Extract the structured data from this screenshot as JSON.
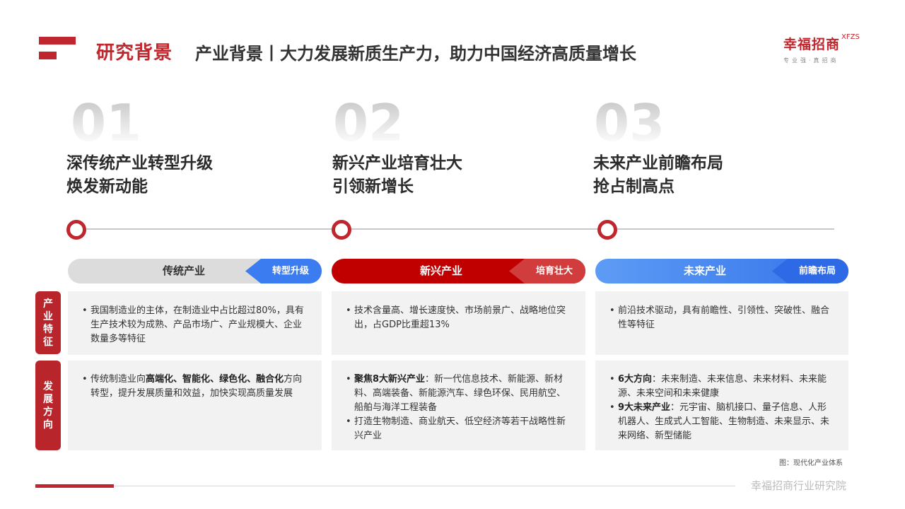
{
  "header": {
    "section": "研究背景",
    "title": "产业背景丨大力发展新质生产力，助力中国经济高质量增长",
    "brand_name": "幸福招商",
    "brand_abbr": "XFZS",
    "brand_slogan": "专业强·真招商"
  },
  "columns": [
    {
      "number": "01",
      "title_line1": "深传统产业转型升级",
      "title_line2": "焕发新动能",
      "pill_label": "传统产业",
      "pill_tag": "转型升级"
    },
    {
      "number": "02",
      "title_line1": "新兴产业培育壮大",
      "title_line2": "引领新增长",
      "pill_label": "新兴产业",
      "pill_tag": "培育壮大"
    },
    {
      "number": "03",
      "title_line1": "未来产业前瞻布局",
      "title_line2": "抢占制高点",
      "pill_label": "未来产业",
      "pill_tag": "前瞻布局"
    }
  ],
  "row_labels": {
    "features": "产业特征",
    "direction": "发展方向"
  },
  "features": [
    "我国制造业的主体，在制造业中占比超过80%，具有生产技术较为成熟、产品市场广、产业规模大、企业数量多等特征",
    "技术含量高、增长速度快、市场前景广、战略地位突出，占GDP比重超13%",
    "前沿技术驱动，具有前瞻性、引领性、突破性、融合性等特征"
  ],
  "direction": {
    "traditional": {
      "prefix": "传统制造业向",
      "k1": "高端化",
      "sep1": "、",
      "k2": "智能化",
      "sep2": "、",
      "k3": "绿色化",
      "sep3": "、",
      "k4": "融合化",
      "suffix": "方向转型，提升发展质量和效益，加快实现高质量发展"
    },
    "emerging": {
      "b1_bold": "聚焦8大新兴产业",
      "b1_text": "：新一代信息技术、新能源、新材料、高端装备、新能源汽车、绿色环保、民用航空、船舶与海洋工程装备",
      "b2_text": "打造生物制造、商业航天、低空经济等若干战略性新兴产业"
    },
    "future": {
      "b1_bold": "6大方向",
      "b1_text": "：未来制造、未来信息、未来材料、未来能源、未来空间和未来健康",
      "b2_bold": "9大未来产业",
      "b2_text": "：元宇宙、脑机接口、量子信息、人形机器人、生成式人工智能、生物制造、未来显示、未来网络、新型储能"
    }
  },
  "caption": "图：现代化产业体系",
  "footer": "幸福招商行业研究院",
  "colors": {
    "brand_red": "#c0262d",
    "emerging_red": "#c00000",
    "future_blue": "#3b7cf0",
    "traditional_gray": "#dcdcdc"
  }
}
